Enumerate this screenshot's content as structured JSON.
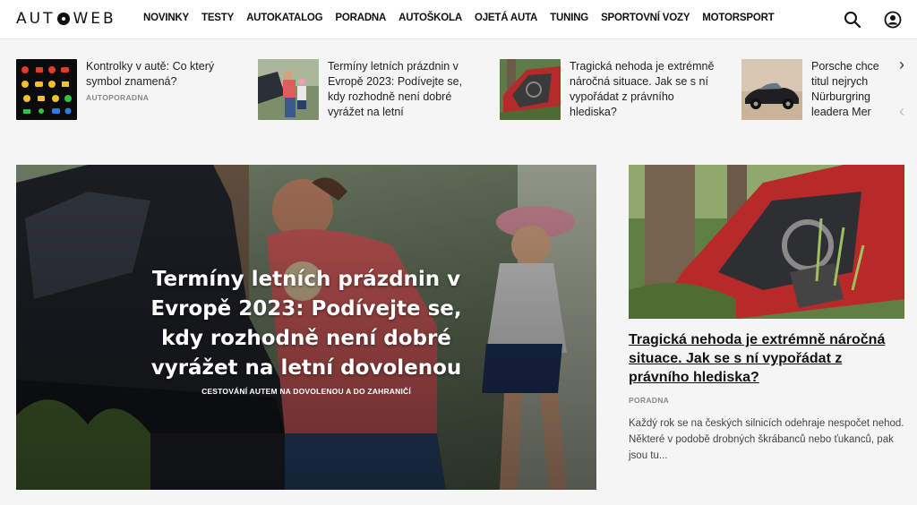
{
  "brand": {
    "logo_left": "AUT",
    "logo_right": "WEB"
  },
  "nav": {
    "items": [
      "NOVINKY",
      "TESTY",
      "AUTOKATALOG",
      "PORADNA",
      "AUTOŠKOLA",
      "OJETÁ AUTA",
      "TUNING",
      "SPORTOVNÍ VOZY",
      "MOTORSPORT"
    ]
  },
  "icons": {
    "search": "search-icon",
    "user": "user-icon",
    "next": "chevron-right-icon",
    "prev": "chevron-left-icon"
  },
  "strip": {
    "items": [
      {
        "title": "Kontrolky v autě: Co který symbol znamená?",
        "category": "AUTOPORADNA"
      },
      {
        "title": "Termíny letních prázdnin v Evropě 2023: Podívejte se, kdy rozhodně není dobré vyrážet na letní",
        "category": ""
      },
      {
        "title": "Tragická nehoda je extrémně náročná situace. Jak se s ní vypořádat z právního hlediska?",
        "category": ""
      },
      {
        "title": "Porsche chce titul nejrych Nürburgring leadera Mer",
        "category": ""
      }
    ],
    "next_label": "›",
    "prev_label": "‹"
  },
  "hero": {
    "title": "Termíny letních prázdnin v Evropě 2023: Podívejte se, kdy rozhodně není dobré vyrážet na letní dovolenou",
    "category": "CESTOVÁNÍ AUTEM NA DOVOLENOU A DO ZAHRANIČÍ"
  },
  "side": {
    "title": "Tragická nehoda je extrémně náročná situace. Jak se s ní vypořádat z právního hlediska?",
    "category": "PORADNA",
    "description": "Každý rok se na českých silnicích odehraje nespočet nehod. Některé v podobě drobných škrábanců nebo ťukanců, pak jsou tu..."
  }
}
